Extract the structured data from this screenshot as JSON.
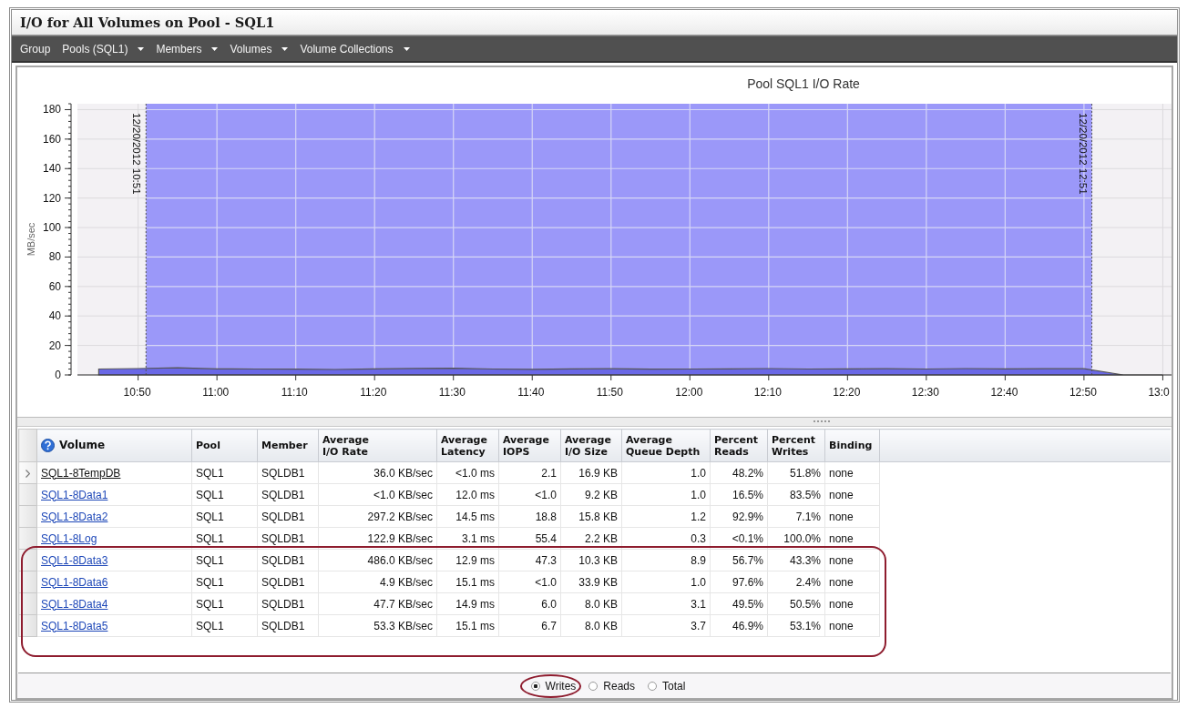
{
  "window": {
    "title": "I/O for All Volumes on Pool - SQL1"
  },
  "menu": [
    {
      "label": "Group",
      "dropdown": false
    },
    {
      "label": "Pools (SQL1)",
      "dropdown": true
    },
    {
      "label": "Members",
      "dropdown": true
    },
    {
      "label": "Volumes",
      "dropdown": true
    },
    {
      "label": "Volume Collections",
      "dropdown": true
    }
  ],
  "chart": {
    "chart_data": {
      "type": "area",
      "title": "Pool SQL1 I/O Rate",
      "ylabel": "MB/sec",
      "categories": [
        null,
        "10:50",
        null,
        "11:00",
        null,
        "11:10",
        null,
        "11:20",
        null,
        "11:30",
        null,
        "11:40",
        null,
        "11:50",
        null,
        "12:00",
        null,
        "12:10",
        null,
        "12:20",
        null,
        "12:30",
        null,
        "12:40",
        null,
        "12:50",
        null,
        "13:0"
      ],
      "series": [
        {
          "color": "#6a68e6",
          "values": [
            4.0,
            4.3,
            4.8,
            4.1,
            4.0,
            3.9,
            3.7,
            4.1,
            4.4,
            4.6,
            4.0,
            3.8,
            4.1,
            4.2,
            3.9,
            4.0,
            4.1,
            4.3,
            4.0,
            4.1,
            4.2,
            4.0,
            4.3,
            4.1,
            4.2,
            4.2,
            0,
            0
          ]
        }
      ],
      "ylim": [
        0,
        184
      ],
      "yticks": [
        0,
        20,
        40,
        60,
        80,
        100,
        120,
        140,
        160,
        180
      ],
      "grid": true,
      "annotations": [
        "12/20/2012 10:51",
        "12/20/2012 12:51"
      ]
    }
  },
  "table": {
    "columns": [
      {
        "label": "Volume",
        "kind": "link"
      },
      {
        "label": "Pool",
        "kind": "text"
      },
      {
        "label": "Member",
        "kind": "text"
      },
      {
        "label": "Average I/O Rate",
        "kind": "number"
      },
      {
        "label": "Average Latency",
        "kind": "number"
      },
      {
        "label": "Average IOPS",
        "kind": "number"
      },
      {
        "label": "Average I/O Size",
        "kind": "number"
      },
      {
        "label": "Average Queue Depth",
        "kind": "number"
      },
      {
        "label": "Percent Reads",
        "kind": "number"
      },
      {
        "label": "Percent Writes",
        "kind": "number"
      },
      {
        "label": "Binding",
        "kind": "text"
      }
    ],
    "rows": [
      {
        "current": true,
        "highlighted": false,
        "cells": [
          "SQL1-8TempDB",
          "SQL1",
          "SQLDB1",
          "36.0 KB/sec",
          "<1.0 ms",
          "2.1",
          "16.9 KB",
          "1.0",
          "48.2%",
          "51.8%",
          "none"
        ]
      },
      {
        "current": false,
        "highlighted": false,
        "cells": [
          "SQL1-8Data1",
          "SQL1",
          "SQLDB1",
          "<1.0 KB/sec",
          "12.0 ms",
          "<1.0",
          "9.2 KB",
          "1.0",
          "16.5%",
          "83.5%",
          "none"
        ]
      },
      {
        "current": false,
        "highlighted": false,
        "cells": [
          "SQL1-8Data2",
          "SQL1",
          "SQLDB1",
          "297.2 KB/sec",
          "14.5 ms",
          "18.8",
          "15.8 KB",
          "1.2",
          "92.9%",
          "7.1%",
          "none"
        ]
      },
      {
        "current": false,
        "highlighted": false,
        "cells": [
          "SQL1-8Log",
          "SQL1",
          "SQLDB1",
          "122.9 KB/sec",
          "3.1 ms",
          "55.4",
          "2.2 KB",
          "0.3",
          "<0.1%",
          "100.0%",
          "none"
        ]
      },
      {
        "current": false,
        "highlighted": true,
        "cells": [
          "SQL1-8Data3",
          "SQL1",
          "SQLDB1",
          "486.0 KB/sec",
          "12.9 ms",
          "47.3",
          "10.3 KB",
          "8.9",
          "56.7%",
          "43.3%",
          "none"
        ]
      },
      {
        "current": false,
        "highlighted": true,
        "cells": [
          "SQL1-8Data6",
          "SQL1",
          "SQLDB1",
          "4.9 KB/sec",
          "15.1 ms",
          "<1.0",
          "33.9 KB",
          "1.0",
          "97.6%",
          "2.4%",
          "none"
        ]
      },
      {
        "current": false,
        "highlighted": true,
        "cells": [
          "SQL1-8Data4",
          "SQL1",
          "SQLDB1",
          "47.7 KB/sec",
          "14.9 ms",
          "6.0",
          "8.0 KB",
          "3.1",
          "49.5%",
          "50.5%",
          "none"
        ]
      },
      {
        "current": false,
        "highlighted": true,
        "cells": [
          "SQL1-8Data5",
          "SQL1",
          "SQLDB1",
          "53.3 KB/sec",
          "15.1 ms",
          "6.7",
          "8.0 KB",
          "3.7",
          "46.9%",
          "53.1%",
          "none"
        ]
      }
    ]
  },
  "view_options": [
    {
      "label": "Writes",
      "selected": true,
      "highlighted": true
    },
    {
      "label": "Reads",
      "selected": false,
      "highlighted": false
    },
    {
      "label": "Total",
      "selected": false,
      "highlighted": false
    }
  ]
}
